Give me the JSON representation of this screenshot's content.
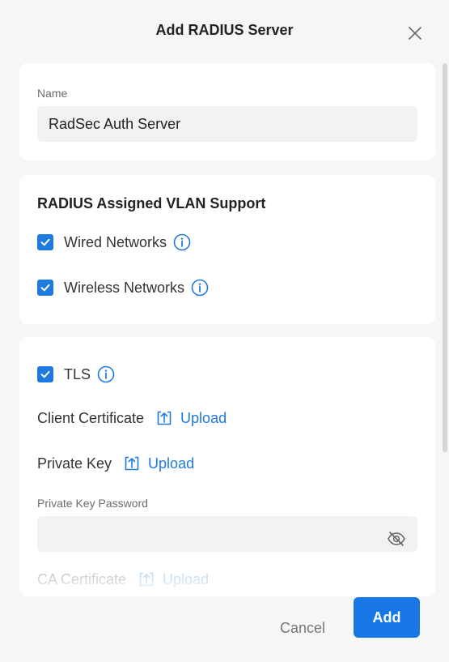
{
  "dialog": {
    "title": "Add RADIUS Server",
    "close_icon": "close-icon"
  },
  "name_section": {
    "label": "Name",
    "value": "RadSec Auth Server"
  },
  "vlan_section": {
    "title": "RADIUS Assigned VLAN Support",
    "options": [
      {
        "label": "Wired Networks",
        "checked": true,
        "icon": "info-icon"
      },
      {
        "label": "Wireless Networks",
        "checked": true,
        "icon": "info-icon"
      }
    ]
  },
  "tls_section": {
    "tls": {
      "label": "TLS",
      "checked": true,
      "icon": "info-icon"
    },
    "client_certificate": {
      "label": "Client Certificate",
      "action": "Upload",
      "icon": "upload-icon"
    },
    "private_key": {
      "label": "Private Key",
      "action": "Upload",
      "icon": "upload-icon"
    },
    "private_key_password": {
      "label": "Private Key Password",
      "value": "",
      "icon": "eye-off-icon"
    },
    "ca_certificate": {
      "label": "CA Certificate",
      "action": "Upload",
      "icon": "upload-icon"
    }
  },
  "footer": {
    "cancel_label": "Cancel",
    "add_label": "Add"
  },
  "colors": {
    "accent": "#1677e5",
    "background": "#f6f6f6",
    "card": "#ffffff",
    "input_bg": "#f2f2f2"
  }
}
